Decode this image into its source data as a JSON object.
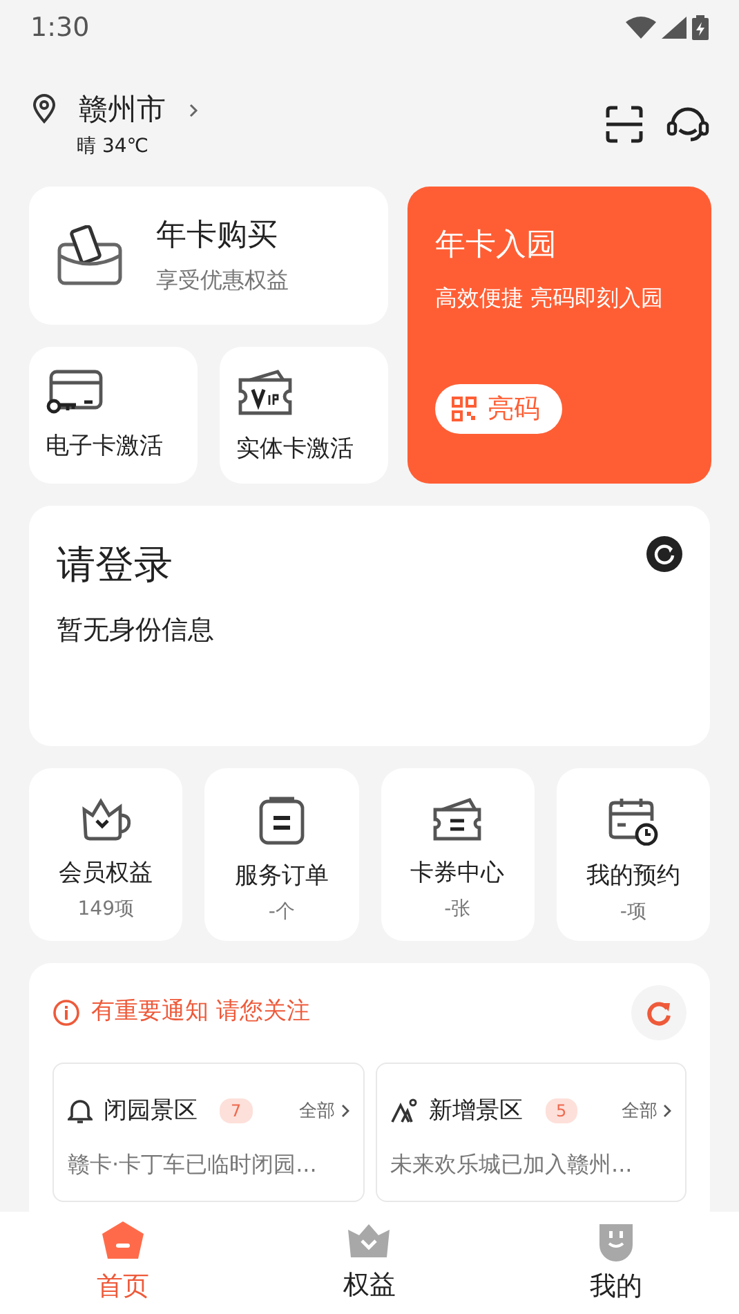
{
  "status_bar": {
    "time": "1:30"
  },
  "location": {
    "city": "赣州市",
    "weather": "晴 34℃"
  },
  "purchase": {
    "title": "年卡购买",
    "subtitle": "享受优惠权益"
  },
  "activations": [
    {
      "kind": "electronic",
      "label": "电子卡激活"
    },
    {
      "kind": "physical",
      "label": "实体卡激活"
    }
  ],
  "entry": {
    "title": "年卡入园",
    "subtitle": "高效便捷 亮码即刻入园",
    "button": "亮码"
  },
  "login": {
    "title": "请登录",
    "subtitle": "暂无身份信息"
  },
  "stats": [
    {
      "kind": "benefits",
      "label": "会员权益",
      "value": "149项"
    },
    {
      "kind": "orders",
      "label": "服务订单",
      "value": "-个"
    },
    {
      "kind": "coupons",
      "label": "卡券中心",
      "value": "-张"
    },
    {
      "kind": "bookings",
      "label": "我的预约",
      "value": "-项"
    }
  ],
  "notice": {
    "title": "有重要通知 请您关注",
    "groups": [
      {
        "kind": "closed",
        "title": "闭园景区",
        "count": "7",
        "more": "全部",
        "text": "赣卡·卡丁车已临时闭园..."
      },
      {
        "kind": "new",
        "title": "新增景区",
        "count": "5",
        "more": "全部",
        "text": "未来欢乐城已加入赣州..."
      }
    ]
  },
  "tabs": [
    {
      "kind": "home",
      "label": "首页",
      "selected": true
    },
    {
      "kind": "benefits",
      "label": "权益",
      "selected": false
    },
    {
      "kind": "mine",
      "label": "我的",
      "selected": false
    }
  ]
}
